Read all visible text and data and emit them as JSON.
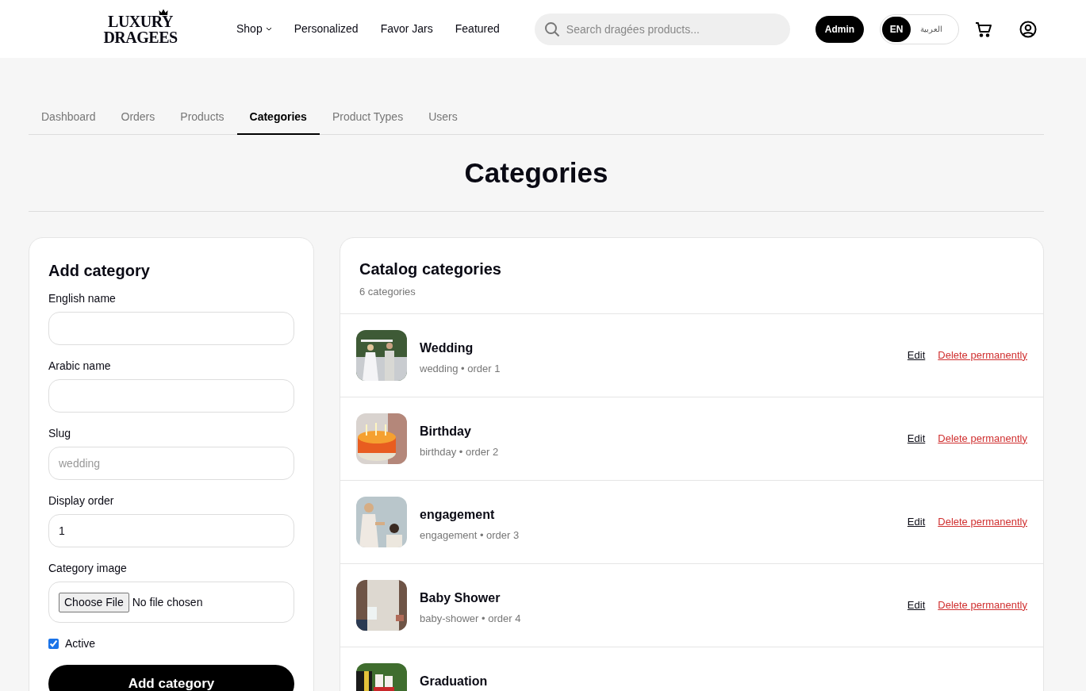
{
  "header": {
    "logo": [
      "LUXURY",
      "DRAGEES"
    ],
    "nav": [
      {
        "label": "Shop",
        "dropdown": true
      },
      {
        "label": "Personalized",
        "dropdown": false
      },
      {
        "label": "Favor Jars",
        "dropdown": false
      },
      {
        "label": "Featured",
        "dropdown": false
      }
    ],
    "search": {
      "placeholder": "Search dragées products..."
    },
    "admin_badge": "Admin",
    "languages": [
      {
        "label": "EN",
        "selected": true
      },
      {
        "label": "العربية",
        "selected": false
      }
    ]
  },
  "tabs": [
    {
      "label": "Dashboard",
      "selected": false
    },
    {
      "label": "Orders",
      "selected": false
    },
    {
      "label": "Products",
      "selected": false
    },
    {
      "label": "Categories",
      "selected": true
    },
    {
      "label": "Product Types",
      "selected": false
    },
    {
      "label": "Users",
      "selected": false
    }
  ],
  "page_title": "Categories",
  "form": {
    "title": "Add category",
    "fields": [
      {
        "label": "English name",
        "kind": "text"
      },
      {
        "label": "Arabic name",
        "kind": "text"
      },
      {
        "label": "Slug",
        "kind": "text",
        "placeholder": "wedding"
      },
      {
        "label": "Display order",
        "kind": "text",
        "value": "1"
      },
      {
        "label": "Category image",
        "kind": "file",
        "button": "Choose File",
        "value": "No file chosen"
      }
    ],
    "active": {
      "label": "Active",
      "checked": true
    },
    "submit": "Add category"
  },
  "catalog": {
    "title": "Catalog categories",
    "count": "6 categories",
    "rows": [
      {
        "name": "Wedding",
        "meta": "wedding • order 1",
        "edit": "Edit",
        "delete": "Delete permanently"
      },
      {
        "name": "Birthday",
        "meta": "birthday • order 2",
        "edit": "Edit",
        "delete": "Delete permanently"
      },
      {
        "name": "engagement",
        "meta": "engagement • order 3",
        "edit": "Edit",
        "delete": "Delete permanently"
      },
      {
        "name": "Baby Shower",
        "meta": "baby-shower • order 4",
        "edit": "Edit",
        "delete": "Delete permanently"
      },
      {
        "name": "Graduation"
      }
    ]
  }
}
